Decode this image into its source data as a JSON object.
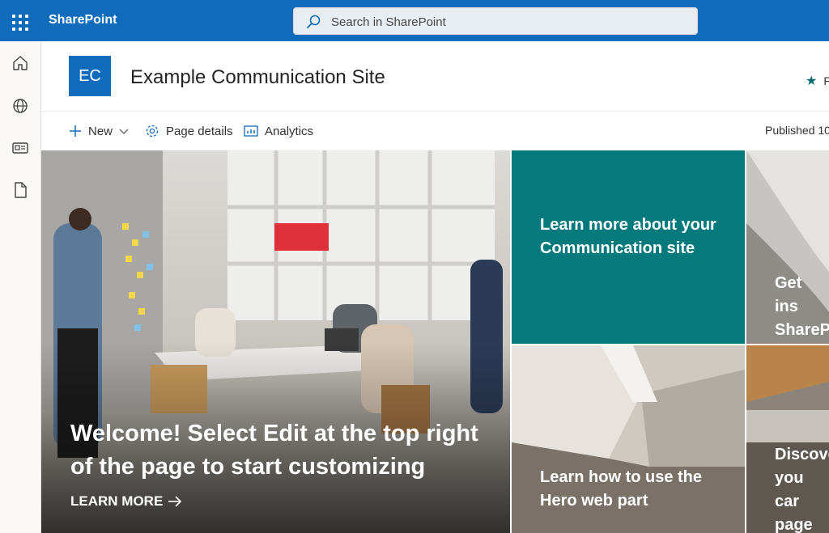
{
  "suitebar": {
    "brand": "SharePoint",
    "search_placeholder": "Search in SharePoint",
    "icons": [
      "app-launcher-icon",
      "search-icon"
    ]
  },
  "rail": {
    "items": [
      {
        "name": "home-icon"
      },
      {
        "name": "globe-icon"
      },
      {
        "name": "news-icon"
      },
      {
        "name": "document-icon"
      }
    ]
  },
  "site": {
    "logo_text": "EC",
    "title": "Example Communication Site",
    "follow_label": "F"
  },
  "command": {
    "new_label": "New",
    "page_details_label": "Page details",
    "analytics_label": "Analytics",
    "published_text": "Published 10"
  },
  "hero": {
    "main_title": "Welcome! Select Edit at the top right of the page to start customizing",
    "main_link": "LEARN MORE",
    "tile2_title": "Learn more about your Communication site",
    "tile3_title": "Get ins SharePo",
    "tile4_title": "Learn how to use the Hero web part",
    "tile5_title": "Discove you car page"
  },
  "colors": {
    "suite_blue": "#0f6cbd",
    "teal": "#057a7c"
  }
}
